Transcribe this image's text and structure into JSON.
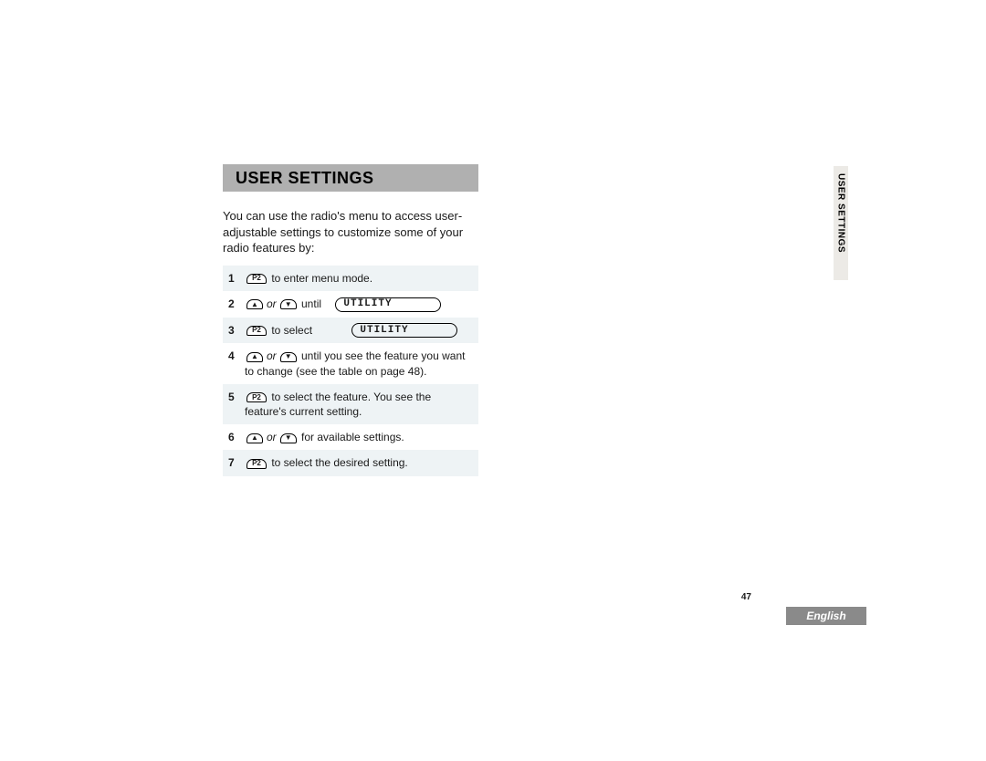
{
  "title": "USER SETTINGS",
  "intro": "You can use the radio's menu to access user-adjustable settings to customize some of your radio features by:",
  "steps": [
    {
      "num": "1",
      "text_after": " to enter menu mode."
    },
    {
      "num": "2",
      "until": " until",
      "lcd": "UTILITY"
    },
    {
      "num": "3",
      "text_after": " to select",
      "lcd": "UTILITY"
    },
    {
      "num": "4",
      "until": " until you see the feature you want to change (see the table on page 48)."
    },
    {
      "num": "5",
      "text_after": " to select the feature. You see the feature's current setting."
    },
    {
      "num": "6",
      "until": " for available settings."
    },
    {
      "num": "7",
      "text_after": " to select the desired setting."
    }
  ],
  "icons": {
    "p2": "P2",
    "up": "▲",
    "down": "▼",
    "or": "or"
  },
  "side_tab": "USER SETTINGS",
  "page_number": "47",
  "language": "English"
}
